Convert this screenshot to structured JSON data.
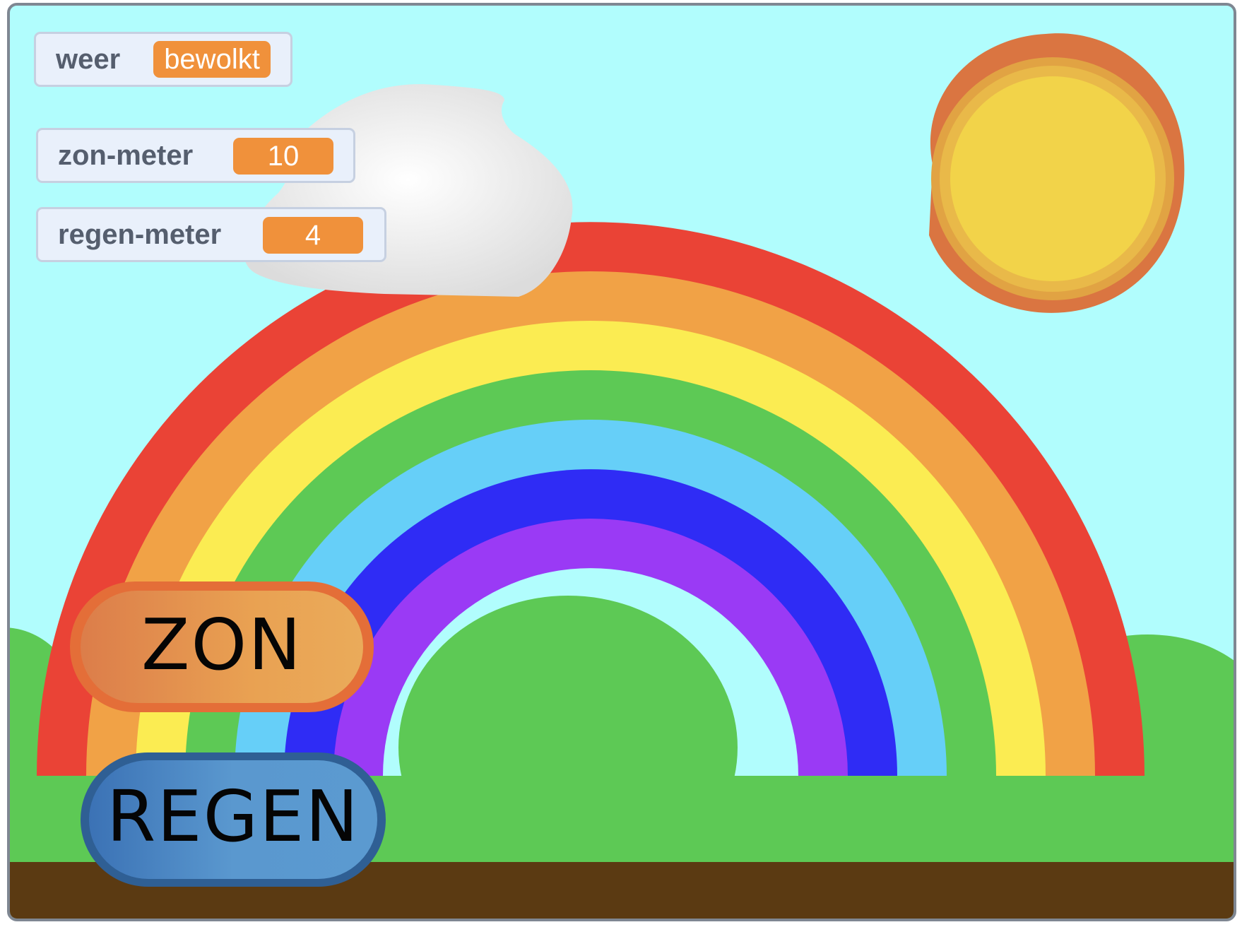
{
  "stage": {
    "sky_color": "#b1fdfd",
    "grass_color": "#5dc955",
    "ground_color": "#5b3a12",
    "rainbow_colors": [
      "#ea4336",
      "#f1a246",
      "#fbec52",
      "#5dc955",
      "#66cff8",
      "#2f2cf5",
      "#9a3af5"
    ]
  },
  "monitors": {
    "weer": {
      "label": "weer",
      "value": "bewolkt"
    },
    "zon_meter": {
      "label": "zon-meter",
      "value": "10"
    },
    "regen_meter": {
      "label": "regen-meter",
      "value": "4"
    },
    "value_color": "#f0913b"
  },
  "sprites": {
    "sun": {
      "icon": "sun-icon",
      "color": "#f2d349"
    },
    "cloud": {
      "icon": "cloud-icon",
      "color": "#f2f2f2"
    }
  },
  "buttons": {
    "zon": {
      "label": "ZON",
      "color": "#e9a152"
    },
    "regen": {
      "label": "REGEN",
      "color": "#4a8bc8"
    }
  }
}
